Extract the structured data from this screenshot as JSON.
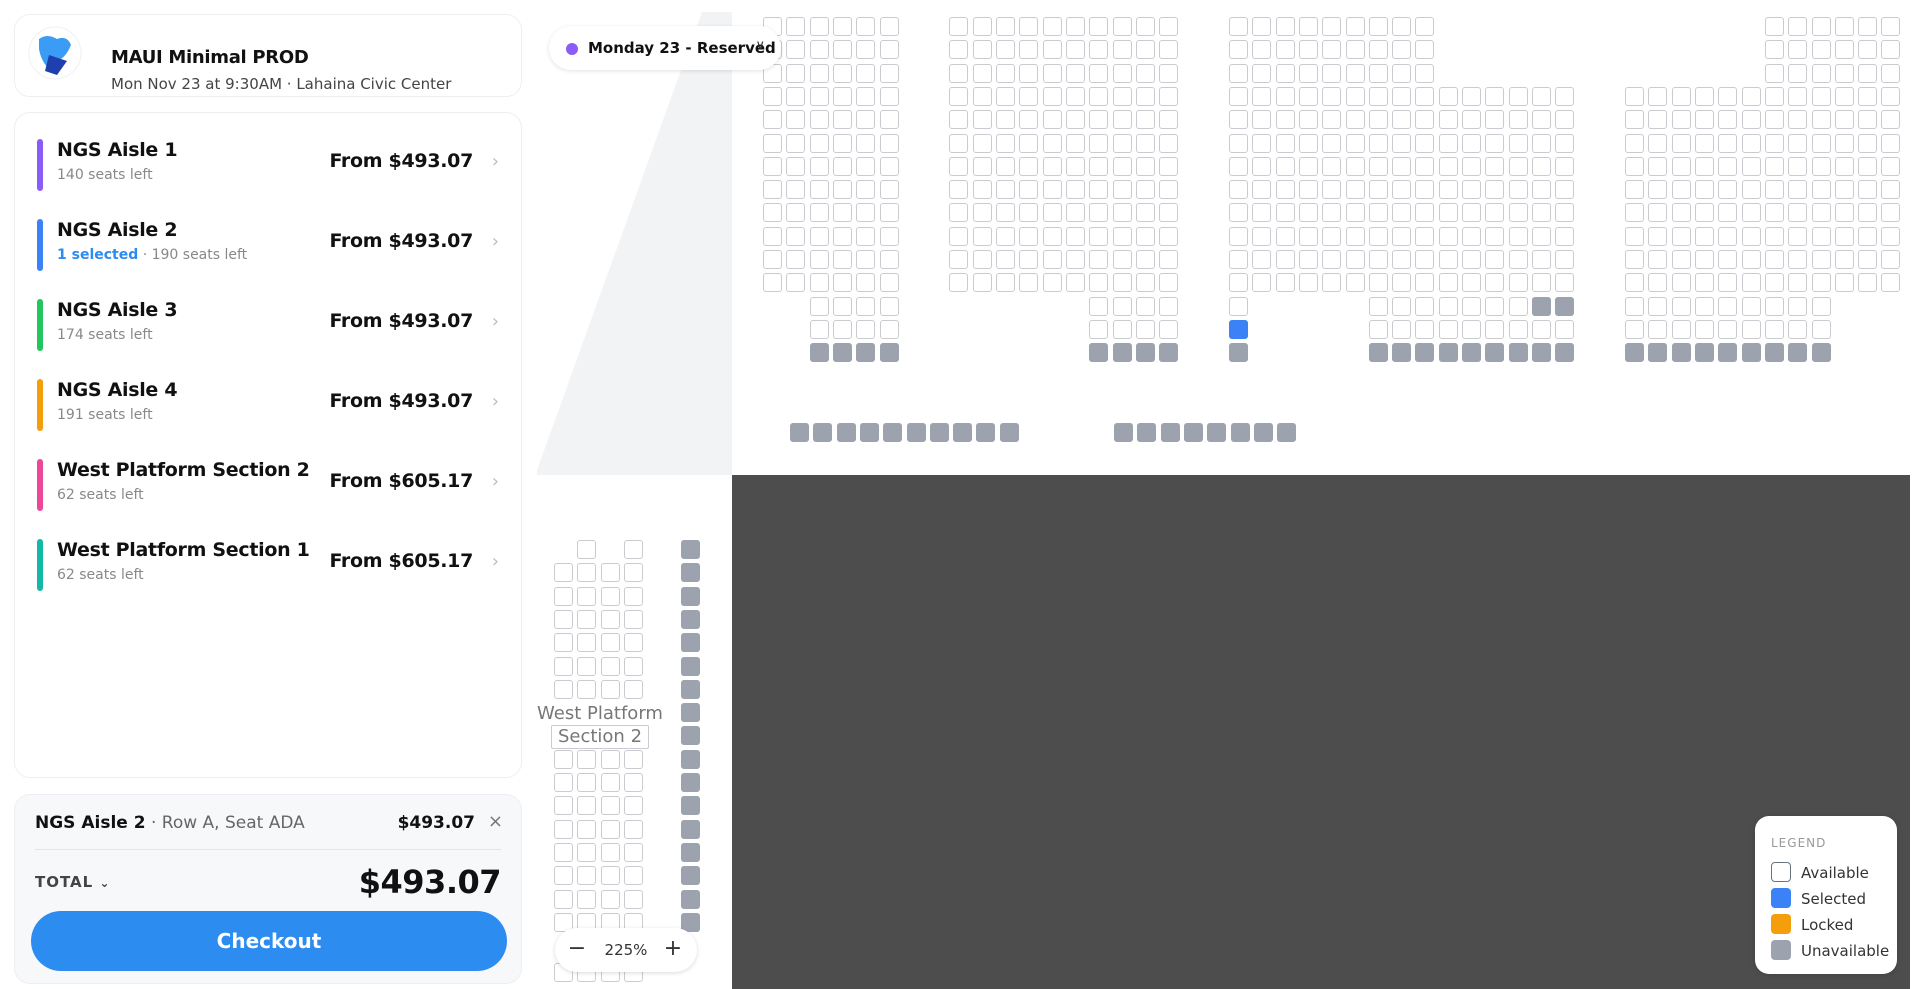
{
  "event": {
    "title": "MAUI Minimal PROD",
    "subtitle": "Mon Nov 23 at 9:30AM · Lahaina Civic Center"
  },
  "sections": [
    {
      "name": "NGS Aisle 1",
      "selected": "",
      "seats": "140 seats left",
      "price": "From $493.07",
      "color": "#8b5cf6"
    },
    {
      "name": "NGS Aisle 2",
      "selected": "1 selected",
      "seats": " · 190 seats left",
      "price": "From $493.07",
      "color": "#3b82f6"
    },
    {
      "name": "NGS Aisle 3",
      "selected": "",
      "seats": "174 seats left",
      "price": "From $493.07",
      "color": "#22c55e"
    },
    {
      "name": "NGS Aisle 4",
      "selected": "",
      "seats": "191 seats left",
      "price": "From $493.07",
      "color": "#f59e0b"
    },
    {
      "name": "West Platform Section 2",
      "selected": "",
      "seats": "62 seats left",
      "price": "From $605.17",
      "color": "#ec4899"
    },
    {
      "name": "West Platform Section 1",
      "selected": "",
      "seats": "62 seats left",
      "price": "From $605.17",
      "color": "#14b8a6"
    }
  ],
  "cart": {
    "section": "NGS Aisle 2",
    "detail": " · Row A, Seat ADA",
    "price": "$493.07",
    "remove": "×",
    "total_label": "TOTAL",
    "total_value": "$493.07",
    "checkout": "Checkout"
  },
  "map": {
    "date_filter": "Monday 23 - Reserved",
    "section_label_line1": "West Platform",
    "section_label_line2": "Section 2",
    "zoom": "225%",
    "zoom_out": "−",
    "zoom_in": "+"
  },
  "legend": {
    "title": "LEGEND",
    "items": [
      {
        "label": "Available",
        "color": "#ffffff"
      },
      {
        "label": "Selected",
        "color": "#3b82f6"
      },
      {
        "label": "Locked",
        "color": "#f59e0b"
      },
      {
        "label": "Unavailable",
        "color": "#9ca3af"
      }
    ]
  }
}
